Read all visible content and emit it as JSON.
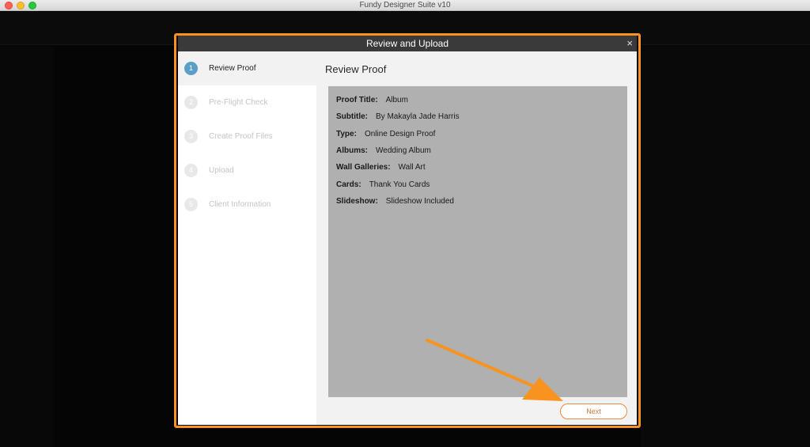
{
  "window": {
    "title": "Fundy Designer Suite v10"
  },
  "dialog": {
    "title": "Review and Upload",
    "close_glyph": "×",
    "steps": [
      {
        "number": "1",
        "label": "Review Proof",
        "active": true
      },
      {
        "number": "2",
        "label": "Pre-Flight Check",
        "active": false
      },
      {
        "number": "3",
        "label": "Create Proof Files",
        "active": false
      },
      {
        "number": "4",
        "label": "Upload",
        "active": false
      },
      {
        "number": "5",
        "label": "Client Information",
        "active": false
      }
    ],
    "main_title": "Review Proof",
    "proof": [
      {
        "key": "Proof Title:",
        "value": "Album"
      },
      {
        "key": "Subtitle:",
        "value": "By Makayla Jade Harris"
      },
      {
        "key": "Type:",
        "value": "Online Design Proof"
      },
      {
        "key": "Albums:",
        "value": "Wedding Album"
      },
      {
        "key": "Wall Galleries:",
        "value": "Wall Art"
      },
      {
        "key": "Cards:",
        "value": "Thank You Cards"
      },
      {
        "key": "Slideshow:",
        "value": "Slideshow Included"
      }
    ],
    "next_label": "Next"
  },
  "colors": {
    "highlight": "#f7931e",
    "step_active": "#5b9ec9",
    "header": "#3a3a3a"
  }
}
